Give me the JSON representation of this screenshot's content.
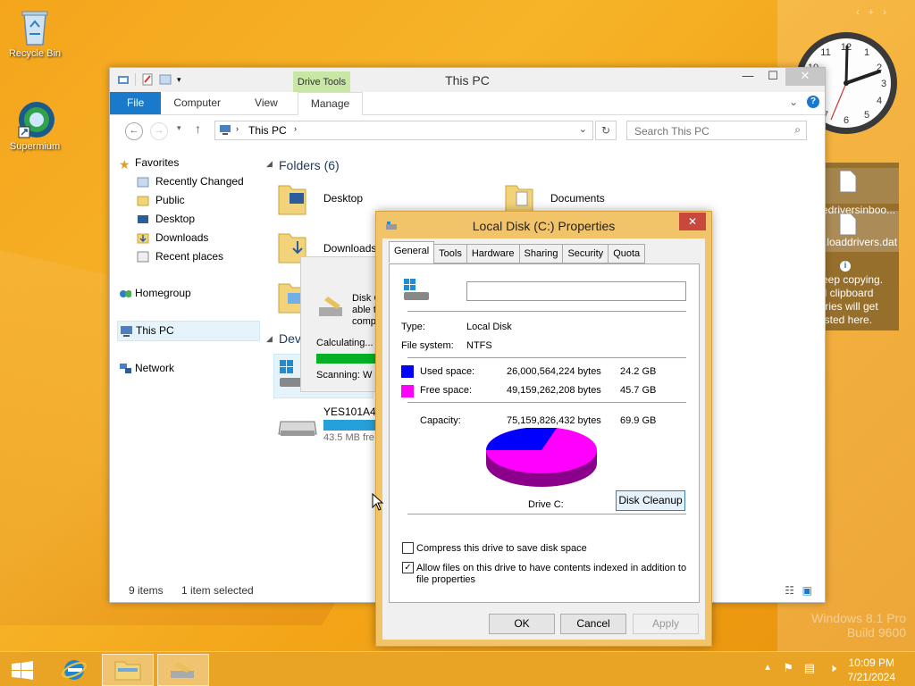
{
  "desktop": {
    "icons": [
      {
        "label": "Recycle Bin"
      },
      {
        "label": "Supermium"
      }
    ]
  },
  "explorer": {
    "title": "This PC",
    "context_tab": "Drive Tools",
    "tabs": [
      "File",
      "Computer",
      "View",
      "Manage"
    ],
    "address": "This PC",
    "search_placeholder": "Search This PC",
    "nav": {
      "favorites": "Favorites",
      "items": [
        "Recently Changed",
        "Public",
        "Desktop",
        "Downloads",
        "Recent places"
      ],
      "homegroup": "Homegroup",
      "thispc": "This PC",
      "network": "Network"
    },
    "folders_header": "Folders (6)",
    "folders": [
      "Desktop",
      "Documents",
      "Downloads"
    ],
    "devices_header": "Dev",
    "drive": {
      "name": "YES101A4 (",
      "free": "43.5 MB fre"
    },
    "status": {
      "items": "9 items",
      "selected": "1 item selected"
    }
  },
  "progress": {
    "line1": "Disk C",
    "line2": "able t",
    "line3": "comp",
    "calculating": "Calculating...",
    "scanning": "Scanning:  W"
  },
  "properties": {
    "title": "Local Disk (C:) Properties",
    "tabs": [
      "General",
      "Tools",
      "Hardware",
      "Sharing",
      "Security",
      "Quota"
    ],
    "name_value": "",
    "type_label": "Type:",
    "type_value": "Local Disk",
    "fs_label": "File system:",
    "fs_value": "NTFS",
    "used_label": "Used space:",
    "used_bytes": "26,000,564,224 bytes",
    "used_gb": "24.2 GB",
    "used_color": "#0000ff",
    "free_label": "Free space:",
    "free_bytes": "49,159,262,208 bytes",
    "free_gb": "45.7 GB",
    "free_color": "#ff00ff",
    "cap_label": "Capacity:",
    "cap_bytes": "75,159,826,432 bytes",
    "cap_gb": "69.9 GB",
    "drive_label": "Drive C:",
    "cleanup": "Disk Cleanup",
    "compress": "Compress this drive to save disk space",
    "index_line1": "Allow files on this drive to have contents indexed in addition to",
    "index_line2": "file properties",
    "ok": "OK",
    "cancel": "Cancel",
    "apply": "Apply"
  },
  "clipboard": {
    "file1": "edriversinboo...",
    "file2": ".loaddrivers.dat",
    "note1": "eep copying.",
    "note2": "ll clipboard",
    "note3": "tries will get",
    "note4": "isted here."
  },
  "taskbar": {
    "time": "10:09 PM",
    "date": "7/21/2024"
  },
  "watermark": {
    "line1": "Windows 8.1 Pro",
    "line2": "Build 9600"
  }
}
